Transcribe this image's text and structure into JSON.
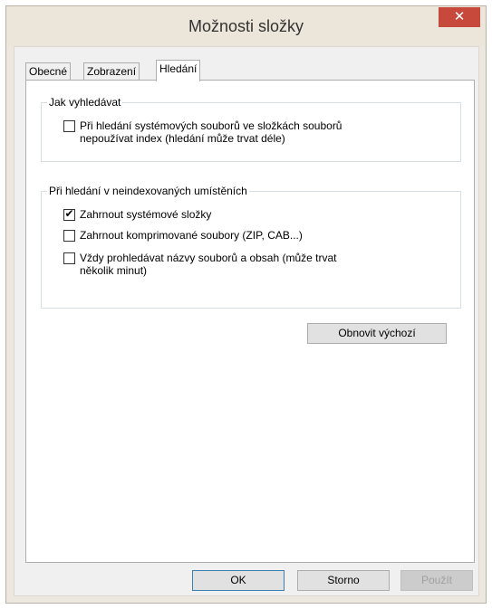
{
  "window": {
    "title": "Možnosti složky",
    "close_glyph": "✕"
  },
  "tabs": [
    {
      "label": "Obecné",
      "active": false
    },
    {
      "label": "Zobrazení",
      "active": false
    },
    {
      "label": "Hledání",
      "active": true
    }
  ],
  "groups": {
    "search_how": {
      "legend": "Jak vyhledávat",
      "options": [
        {
          "label_line1": "Při hledání systémových souborů ve složkách souborů",
          "label_line2": "nepoužívat index (hledání může trvat déle)",
          "checked": false
        }
      ]
    },
    "non_indexed": {
      "legend": "Při hledání v neindexovaných umístěních",
      "options": [
        {
          "label_line1": "Zahrnout systémové složky",
          "label_line2": "",
          "checked": true
        },
        {
          "label_line1": "Zahrnout komprimované soubory (ZIP, CAB...)",
          "label_line2": "",
          "checked": false
        },
        {
          "label_line1": "Vždy prohledávat názvy souborů a obsah (může trvat",
          "label_line2": "několik minut)",
          "checked": false
        }
      ]
    }
  },
  "buttons": {
    "restore_defaults": "Obnovit výchozí",
    "ok": "OK",
    "cancel": "Storno",
    "apply": "Použít"
  },
  "check_glyph": "✔",
  "colors": {
    "close_button": "#c7493b",
    "window_frame": "#ede8df",
    "default_button_border": "#3c7fb1"
  }
}
